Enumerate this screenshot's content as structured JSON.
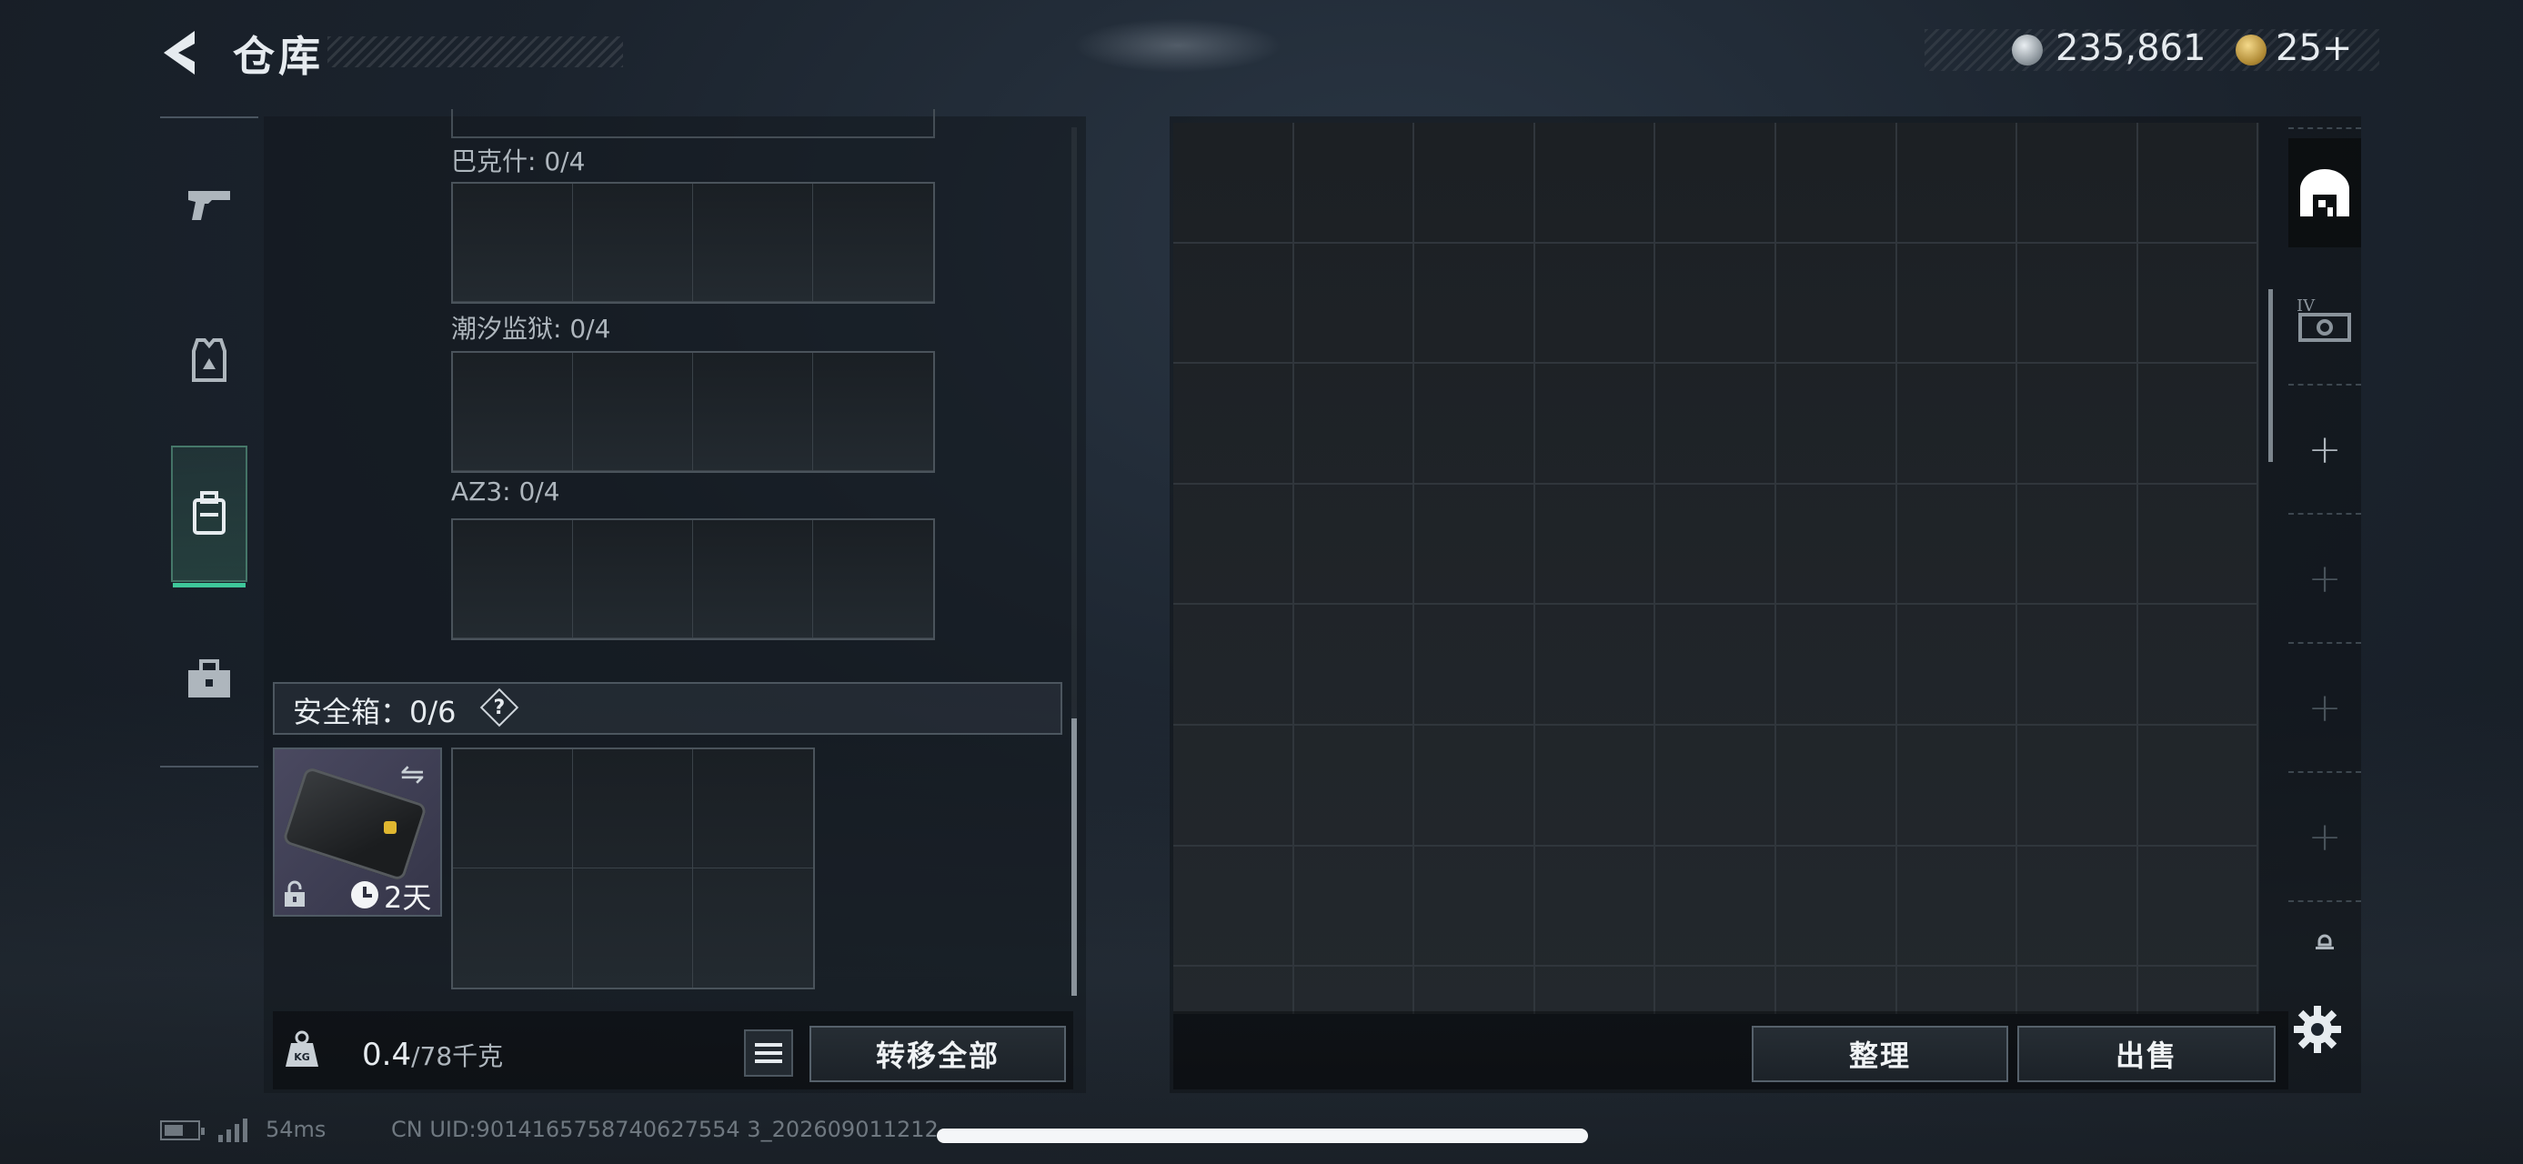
{
  "header": {
    "title": "仓库",
    "currencies": [
      {
        "icon": "silver-coin-icon",
        "value": "235,861"
      },
      {
        "icon": "gold-coin-icon",
        "value": "25+"
      }
    ]
  },
  "categories": [
    {
      "icon": "pistol-icon",
      "active": false
    },
    {
      "icon": "armor-vest-icon",
      "active": false
    },
    {
      "icon": "backpack-icon",
      "active": true
    },
    {
      "icon": "toolbox-icon",
      "active": false
    }
  ],
  "containers": [
    {
      "label": "巴克什: 0/4"
    },
    {
      "label": "潮汐监狱: 0/4"
    },
    {
      "label": "AZ3: 0/4"
    }
  ],
  "safe_box": {
    "title": "安全箱：0/6",
    "help": "?",
    "duration": "2天"
  },
  "capacity": {
    "current": "0.4",
    "max": "/78千克",
    "icon_text": "KG"
  },
  "actions": {
    "transfer_all": "转移全部",
    "sort": "整理",
    "sell": "出售"
  },
  "status": {
    "ping": "54ms",
    "uid": "CN UID:9014165758740627554 3_202609011212"
  },
  "colors": {
    "accent_active": "#3ec79a",
    "gold": "#e0b730",
    "panel_border": "#4a535b"
  }
}
